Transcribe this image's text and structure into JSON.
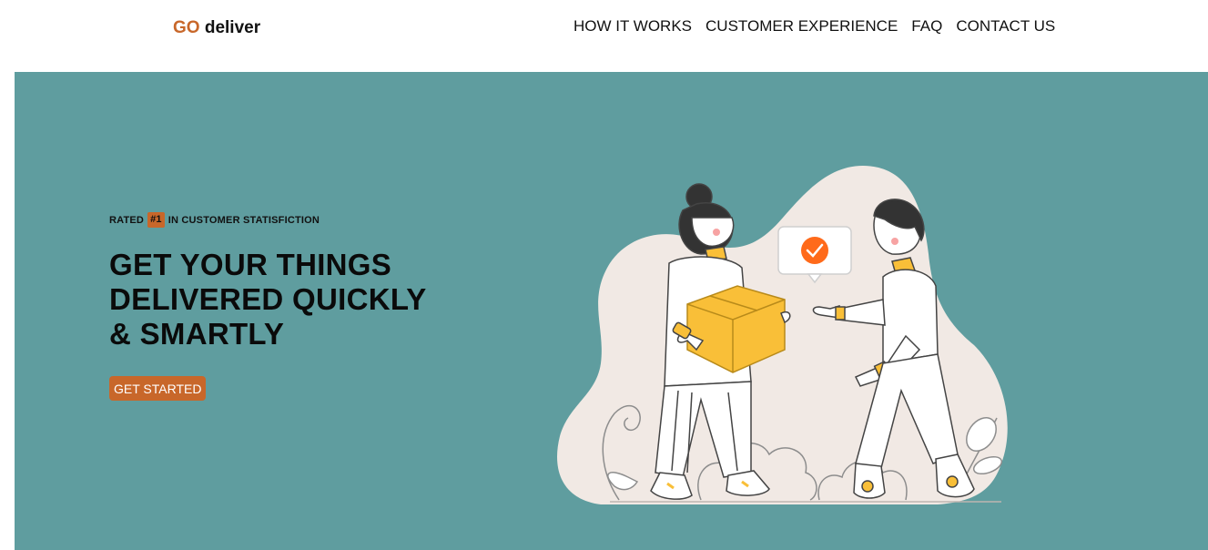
{
  "logo": {
    "go": "GO",
    "rest": "deliver"
  },
  "nav": {
    "items": [
      {
        "label": "HOW IT WORKS"
      },
      {
        "label": "CUSTOMER EXPERIENCE"
      },
      {
        "label": "FAQ"
      },
      {
        "label": "CONTACT US"
      }
    ]
  },
  "hero": {
    "tagline_before": "RATED",
    "tagline_badge": "#1",
    "tagline_after": "IN CUSTOMER STATISFICTION",
    "headline_lines": [
      "GET YOUR THINGS",
      "DELIVERED QUICKLY",
      "& SMARTLY"
    ],
    "cta_label": "GET STARTED"
  },
  "colors": {
    "brand": "#c8672a",
    "hero_bg": "#5f9d9f",
    "illustration_blob": "#f1e9e4",
    "box_yellow": "#f9bf38",
    "check_orange": "#ff6a1a"
  },
  "icons": {
    "illustration": "delivery-handoff-illustration",
    "check": "check-circle-icon"
  }
}
